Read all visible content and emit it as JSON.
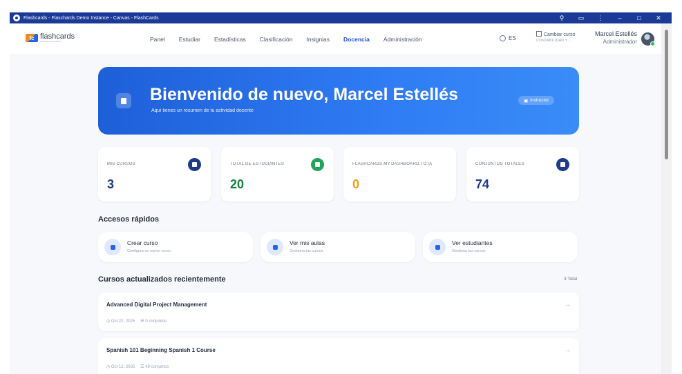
{
  "window": {
    "title": "Flashcards - Flaschards Demo Instance - Canvas - FlashCards"
  },
  "brand": {
    "logo_mark": "fc",
    "name": "flashcards",
    "tagline": "entornos de formación"
  },
  "nav": {
    "items": [
      {
        "label": "Panel"
      },
      {
        "label": "Estudiar"
      },
      {
        "label": "Estadísticas"
      },
      {
        "label": "Clasificación"
      },
      {
        "label": "Insignias"
      },
      {
        "label": "Docencia",
        "active": true
      },
      {
        "label": "Administración"
      }
    ]
  },
  "header": {
    "language": "ES",
    "switch_label": "Cambiar curso",
    "switch_sub": "CONTABILIDAD Y ...",
    "user_name": "Marcel Estellés",
    "user_role": "Administrador"
  },
  "hero": {
    "title": "Bienvenido de nuevo, Marcel Estellés",
    "subtitle": "Aquí tienes un resumen de tu actividad docente",
    "badge": "Instructor"
  },
  "stats": [
    {
      "label": "MIS CURSOS",
      "value": "3",
      "color": "#1e3a8a",
      "icon_color": "#1e3a8a",
      "icon": "graduation-cap-icon"
    },
    {
      "label": "TOTAL DE ESTUDIANTES",
      "value": "20",
      "color": "#15803d",
      "icon_color": "#22a55a",
      "icon": "users-icon"
    },
    {
      "label": "FLASHCARDS.MY.DASHBOARD.TOTALCAR",
      "value": "0",
      "color": "#f59e0b",
      "icon_color": "#f59e0b",
      "icon": ""
    },
    {
      "label": "CONJUNTOS TOTALES",
      "value": "74",
      "color": "#1e3a8a",
      "icon_color": "#1e3a8a",
      "icon": "layers-icon"
    }
  ],
  "quick_access": {
    "title": "Accesos rápidos",
    "items": [
      {
        "title": "Crear curso",
        "subtitle": "Configura un nuevo curso"
      },
      {
        "title": "Ver mis aulas",
        "subtitle": "Gestiona tus cursos"
      },
      {
        "title": "Ver estudiantes",
        "subtitle": "Gestiona tus cursos"
      }
    ]
  },
  "recent": {
    "title": "Cursos actualizados recientemente",
    "total": "3 Total",
    "courses": [
      {
        "name": "Advanced Digital Project Management",
        "date": "Oct 22, 2025",
        "sets": "0 conjuntos"
      },
      {
        "name": "Spanish 101 Beginning Spanish 1 Course",
        "date": "Oct 12, 2025",
        "sets": "49 conjuntos"
      }
    ]
  }
}
